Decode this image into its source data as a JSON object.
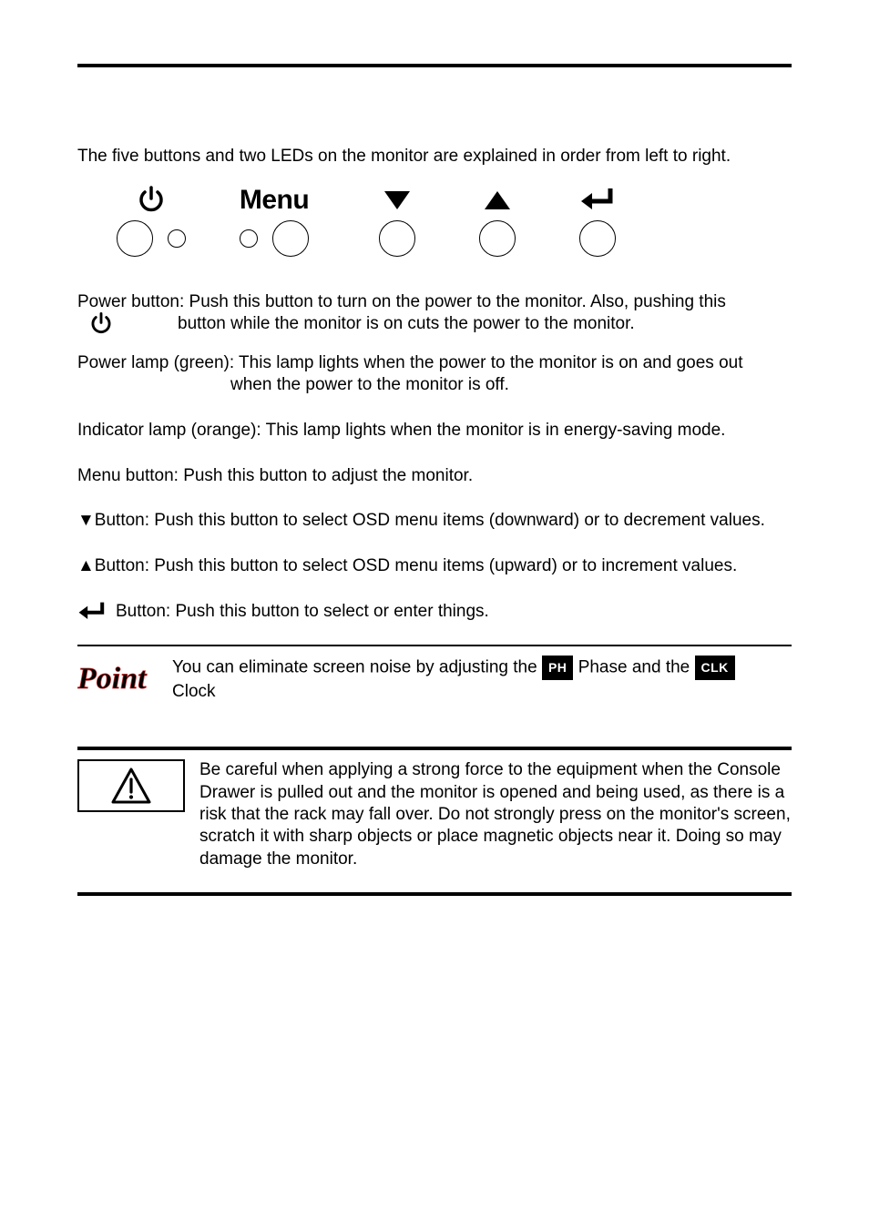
{
  "intro": "The five buttons and two LEDs on the monitor are explained in order from left to right.",
  "buttonRow": {
    "menuLabel": "Menu"
  },
  "desc": {
    "powerButton": "Power button: Push this button to turn on the power to the monitor. Also, pushing this",
    "powerButtonCont": "button while the monitor is on cuts the power to the monitor.",
    "powerLamp": "Power lamp (green): This lamp lights when the power to the monitor is on and goes out",
    "powerLampCont": "when the power to the monitor is off.",
    "indicatorLamp": "Indicator lamp (orange): This lamp lights when the monitor is in energy-saving mode.",
    "menuButton": "Menu button: Push this button to adjust the monitor.",
    "downButton": "▼Button: Push this button to select OSD menu items (downward) or to decrement values.",
    "upButton": "▲Button: Push this button to select OSD menu items (upward) or to increment values.",
    "enterButton": "Button: Push this button to select or enter things."
  },
  "point": {
    "pre": "You can eliminate screen noise by adjusting the",
    "phBadge": "PH",
    "mid": "Phase and the",
    "clkBadge": "CLK",
    "post": "Clock"
  },
  "caution": {
    "text": "Be careful when applying a strong force to the equipment when the Console Drawer is pulled out and the monitor is opened and being used, as there is a risk that the rack may fall over. Do not strongly press on the monitor's screen, scratch it with sharp objects or place magnetic objects near it. Doing so may damage the monitor."
  }
}
